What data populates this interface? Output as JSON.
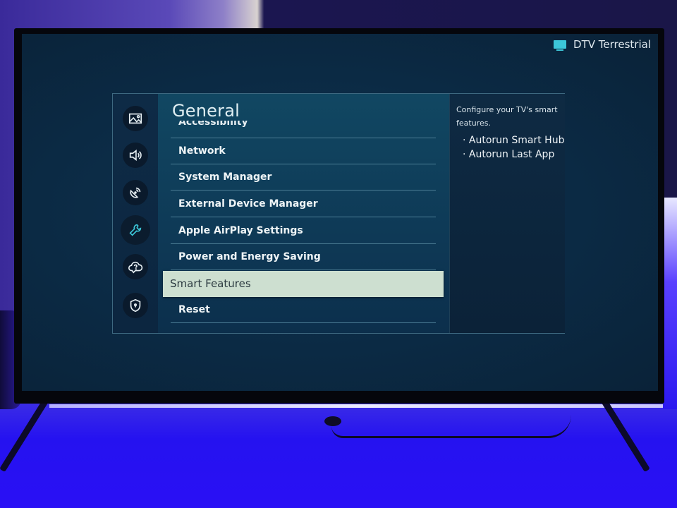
{
  "status": {
    "source_icon": "tv-icon",
    "source_label": "DTV Terrestrial"
  },
  "menu": {
    "title": "General",
    "rail": [
      {
        "name": "picture",
        "icon": "picture-icon",
        "active": false
      },
      {
        "name": "sound",
        "icon": "speaker-icon",
        "active": false
      },
      {
        "name": "broadcasting",
        "icon": "satellite-dish-icon",
        "active": false
      },
      {
        "name": "general",
        "icon": "wrench-icon",
        "active": true
      },
      {
        "name": "support",
        "icon": "cloud-question-icon",
        "active": false
      },
      {
        "name": "privacy",
        "icon": "shield-icon",
        "active": false
      }
    ],
    "partial_item": "Accessibility",
    "items": [
      {
        "label": "Network"
      },
      {
        "label": "System Manager"
      },
      {
        "label": "External Device Manager"
      },
      {
        "label": "Apple AirPlay Settings"
      },
      {
        "label": "Power and Energy Saving"
      },
      {
        "label": "Smart Features",
        "selected": true
      },
      {
        "label": "Reset"
      }
    ],
    "accent_color": "#3cc6d8",
    "selected_color": "#cddfd0"
  },
  "description": {
    "text": "Configure your TV's smart features.",
    "bullets": [
      "Autorun Smart Hub",
      "Autorun Last App"
    ]
  }
}
